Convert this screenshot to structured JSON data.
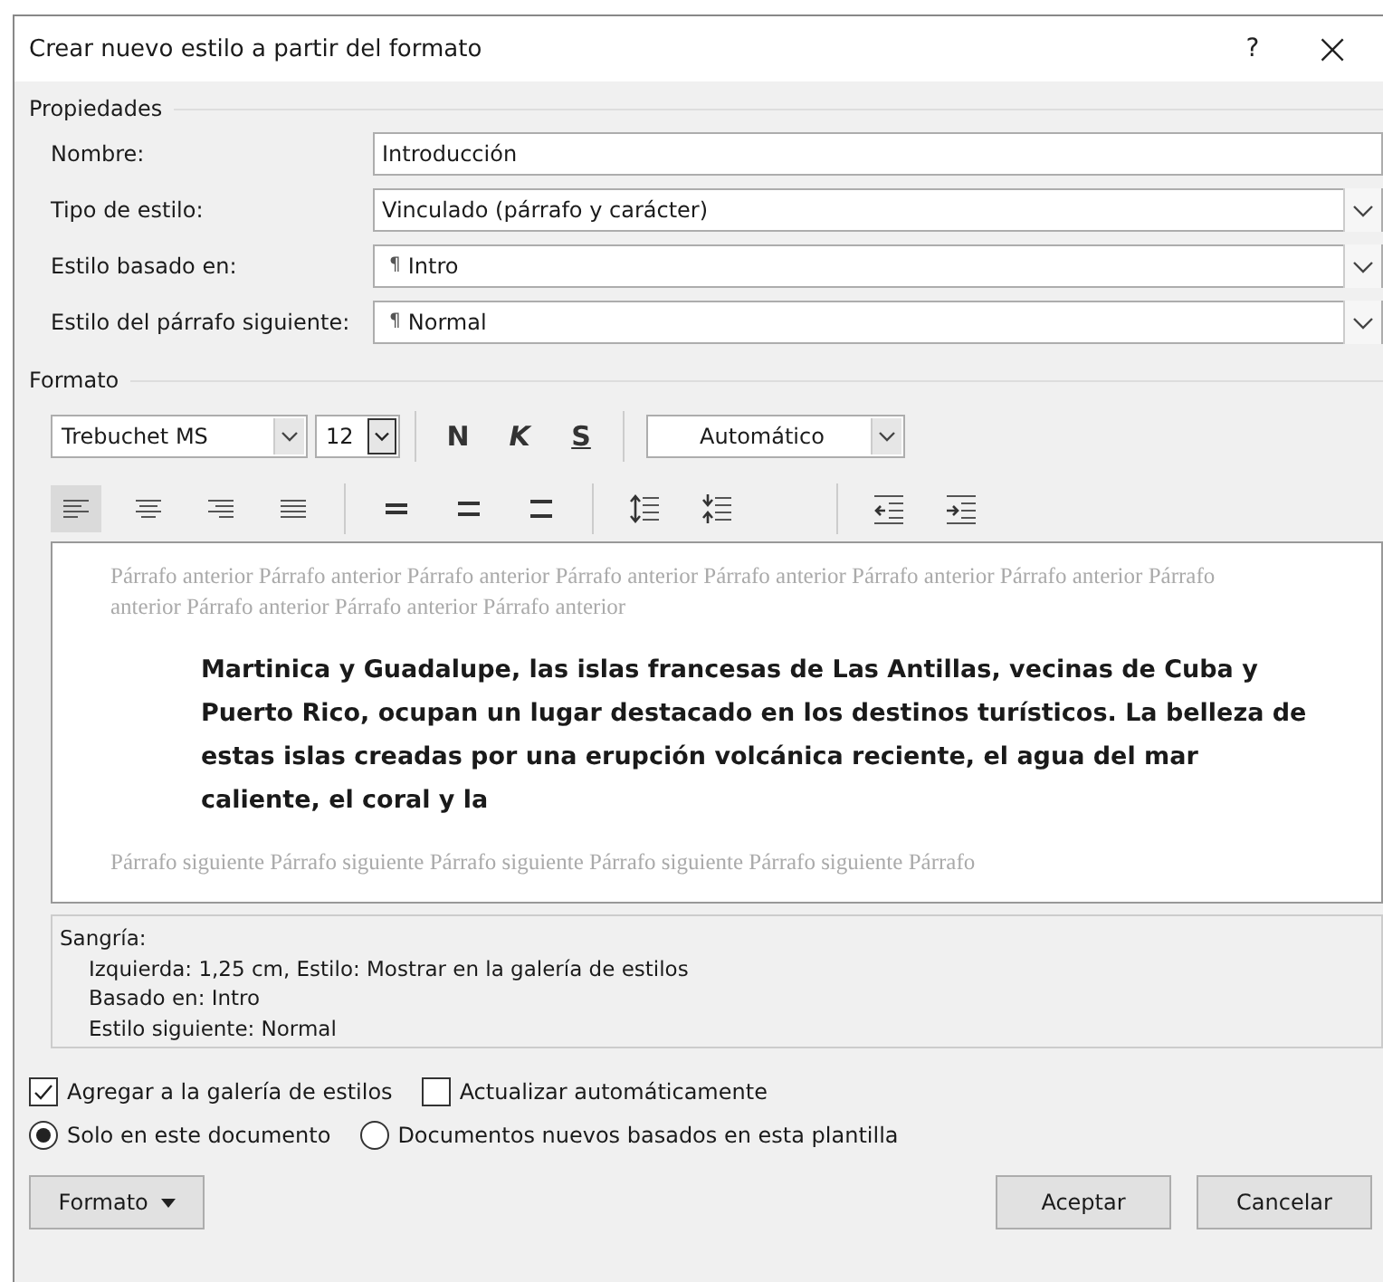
{
  "window": {
    "title": "Crear nuevo estilo a partir del formato",
    "help": "?",
    "close": "×"
  },
  "properties": {
    "legend": "Propiedades",
    "rows": [
      {
        "label": "Nombre:",
        "kind": "text",
        "value": "Introducción"
      },
      {
        "label": "Tipo de estilo:",
        "kind": "select",
        "value": "Vinculado (párrafo y carácter)"
      },
      {
        "label": "Estilo basado en:",
        "kind": "select",
        "value": "Intro",
        "pilcrow": "¶"
      },
      {
        "label": "Estilo del párrafo siguiente:",
        "kind": "select",
        "value": "Normal",
        "pilcrow": "¶"
      }
    ]
  },
  "format": {
    "legend": "Formato",
    "font": "Trebuchet MS",
    "size": "12",
    "bold": "N",
    "italic": "K",
    "underline": "S",
    "font_color": "Automático",
    "paragraph_buttons": [
      {
        "kind": "align-left",
        "selected": true
      },
      {
        "kind": "align-center",
        "selected": false
      },
      {
        "kind": "align-right",
        "selected": false
      },
      {
        "kind": "justify",
        "selected": false
      },
      {
        "kind": "single-spacing",
        "selected": false
      },
      {
        "kind": "one-half-spacing",
        "selected": false
      },
      {
        "kind": "double-spacing",
        "selected": false
      },
      {
        "kind": "spacing-increase",
        "selected": false
      },
      {
        "kind": "spacing-decrease",
        "selected": false
      },
      {
        "kind": "indent-decrease",
        "selected": false
      },
      {
        "kind": "indent-increase",
        "selected": false
      }
    ]
  },
  "preview": {
    "previous": "Párrafo anterior Párrafo anterior Párrafo anterior Párrafo anterior Párrafo anterior Párrafo anterior Párrafo anterior Párrafo anterior Párrafo anterior Párrafo anterior Párrafo anterior",
    "sample": "Martinica y Guadalupe, las islas francesas de Las Antillas, vecinas de Cuba y Puerto Rico, ocupan un lugar destacado en los destinos turísticos. La belleza de estas islas creadas por una erupción volcánica reciente, el agua del mar caliente, el coral y la",
    "next": "Párrafo siguiente Párrafo siguiente Párrafo siguiente Párrafo siguiente Párrafo siguiente Párrafo"
  },
  "description": {
    "heading": "Sangría:",
    "lines": [
      "Izquierda:  1,25 cm, Estilo: Mostrar en la galería de estilos",
      "Basado en: Intro",
      "Estilo siguiente: Normal"
    ]
  },
  "checkboxes": [
    {
      "label": "Agregar a la galería de estilos",
      "checked": true
    },
    {
      "label": "Actualizar automáticamente",
      "checked": false
    }
  ],
  "radios": [
    {
      "label": "Solo en este documento",
      "selected": true
    },
    {
      "label": "Documentos nuevos basados en esta plantilla",
      "selected": false
    }
  ],
  "buttons": {
    "format": "Formato",
    "ok": "Aceptar",
    "cancel": "Cancelar"
  }
}
